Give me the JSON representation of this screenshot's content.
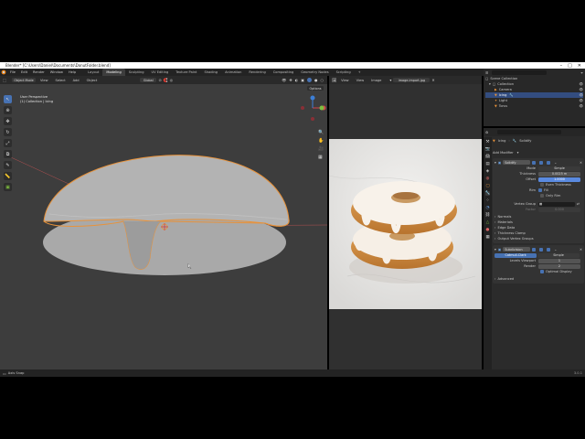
{
  "window": {
    "title": "Blender* [C:\\Users\\Daniel\\Documents\\DonutFolder.blend]"
  },
  "menus": [
    "File",
    "Edit",
    "Render",
    "Window",
    "Help"
  ],
  "workspaces": [
    "Layout",
    "Modeling",
    "Sculpting",
    "UV Editing",
    "Texture Paint",
    "Shading",
    "Animation",
    "Rendering",
    "Compositing",
    "Geometry Nodes",
    "Scripting"
  ],
  "active_workspace": "Modeling",
  "scene": {
    "label": "Scene",
    "view_layer": "ViewLayer"
  },
  "viewport": {
    "mode": "Object Mode",
    "menus": [
      "View",
      "Select",
      "Add",
      "Object"
    ],
    "transform": "Global",
    "options": "Options",
    "overlay_line1": "User Perspective",
    "overlay_line2": "(1) Collection | Icing"
  },
  "image_editor": {
    "menus": [
      "View",
      "View",
      "Image"
    ],
    "filename": "image-import.jpg"
  },
  "outliner": {
    "root": "Scene Collection",
    "items": [
      "Collection",
      "Camera",
      "Icing",
      "Light",
      "Torus"
    ]
  },
  "properties": {
    "breadcrumb_obj": "Icing",
    "breadcrumb_mod": "Solidify",
    "add_modifier": "Add Modifier",
    "solidify": {
      "name": "Solidify",
      "mode_label": "Mode",
      "mode_value": "Simple",
      "thickness_label": "Thickness",
      "thickness_value": "0.0025 m",
      "offset_label": "Offset",
      "offset_value": "1.0000",
      "even_thickness": "Even Thickness",
      "rim_label": "Rim",
      "fill": "Fill",
      "only_rim": "Only Rim",
      "vertex_group_label": "Vertex Group",
      "factor_label": "Factor",
      "factor_value": "0.000",
      "subpanels": [
        "Normals",
        "Materials",
        "Edge Data",
        "Thickness Clamp",
        "Output Vertex Groups"
      ]
    },
    "subdivision": {
      "name": "Subdivision",
      "tab_catmull": "Catmull-Clark",
      "tab_simple": "Simple",
      "levels_label": "Levels Viewport",
      "levels_value": "1",
      "render_label": "Render",
      "render_value": "2",
      "optimal_display": "Optimal Display",
      "advanced": "Advanced"
    }
  },
  "status": {
    "left": "Axis Snap",
    "version": "3.0.1"
  },
  "colors": {
    "accent": "#4772b3",
    "selection_outline": "#e8923a",
    "x_axis": "#d2454c",
    "y_axis": "#7fbf3f",
    "z_axis": "#3d7fd6"
  }
}
